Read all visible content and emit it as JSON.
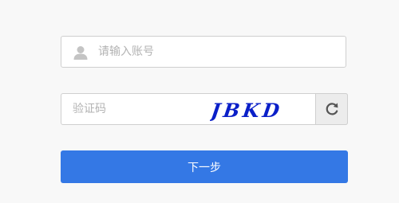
{
  "account": {
    "placeholder": "请输入账号",
    "value": "",
    "icon": "user-icon"
  },
  "captcha": {
    "placeholder": "验证码",
    "value": "",
    "image_text": "JBKD",
    "refresh_icon": "refresh-icon"
  },
  "submit": {
    "label": "下一步"
  },
  "colors": {
    "background": "#f8f8f8",
    "primary_button": "#3478e5",
    "captcha_text": "#0a1fc8",
    "refresh_button_bg": "#ececec"
  }
}
